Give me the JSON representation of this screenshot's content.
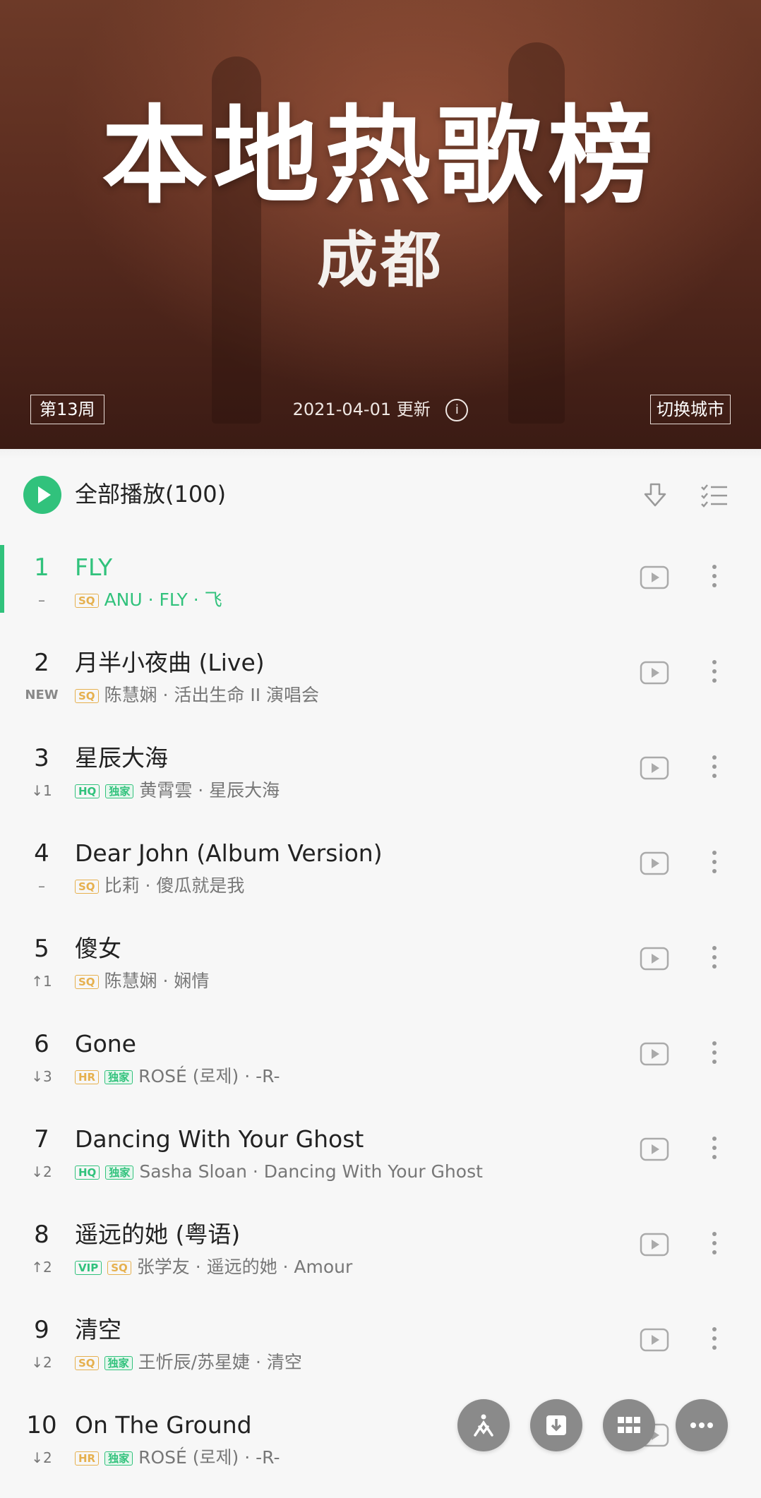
{
  "hero": {
    "title": "本地热歌榜",
    "city": "成都",
    "week": "第13周",
    "update": "2021-04-01 更新",
    "info_icon": "info-icon",
    "switch_city": "切换城市"
  },
  "playall": {
    "label": "全部播放(100)",
    "play_icon": "play-circle-icon",
    "download_icon": "download-icon",
    "multi_select_icon": "multi-select-icon"
  },
  "colors": {
    "accent": "#31c27c",
    "sq": "#e6b04e",
    "hero_bg": "#5a2c1f"
  },
  "songs": [
    {
      "rank": "1",
      "trend": "–",
      "title": "FLY",
      "tags": [
        "SQ"
      ],
      "meta": "ANU · FLY · 飞",
      "active": true
    },
    {
      "rank": "2",
      "trend": "NEW",
      "title": "月半小夜曲 (Live)",
      "tags": [
        "SQ"
      ],
      "meta": "陈慧娴 · 活出生命 II 演唱会"
    },
    {
      "rank": "3",
      "trend": "↓1",
      "title": "星辰大海",
      "tags": [
        "HQ",
        "独家"
      ],
      "meta": "黄霄雲 · 星辰大海"
    },
    {
      "rank": "4",
      "trend": "–",
      "title": "Dear John (Album Version)",
      "tags": [
        "SQ"
      ],
      "meta": "比莉 · 傻瓜就是我"
    },
    {
      "rank": "5",
      "trend": "↑1",
      "title": "傻女",
      "tags": [
        "SQ"
      ],
      "meta": "陈慧娴 · 娴情"
    },
    {
      "rank": "6",
      "trend": "↓3",
      "title": "Gone",
      "tags": [
        "HR",
        "独家"
      ],
      "meta": "ROSÉ (로제) · -R-"
    },
    {
      "rank": "7",
      "trend": "↓2",
      "title": "Dancing With Your Ghost",
      "tags": [
        "HQ",
        "独家"
      ],
      "meta": "Sasha Sloan · Dancing With Your Ghost"
    },
    {
      "rank": "8",
      "trend": "↑2",
      "title": "遥远的她 (粤语)",
      "tags": [
        "VIP",
        "SQ"
      ],
      "meta": "张学友 · 遥远的她 · Amour"
    },
    {
      "rank": "9",
      "trend": "↓2",
      "title": "清空",
      "tags": [
        "SQ",
        "独家"
      ],
      "meta": "王忻辰/苏星婕 · 清空"
    },
    {
      "rank": "10",
      "trend": "↓2",
      "title": "On The Ground",
      "tags": [
        "HR",
        "独家"
      ],
      "meta": "ROSÉ (로제) · -R-"
    }
  ],
  "fabs": [
    "kmusic-icon",
    "download-box-icon",
    "grid-icon",
    "more-icon"
  ]
}
